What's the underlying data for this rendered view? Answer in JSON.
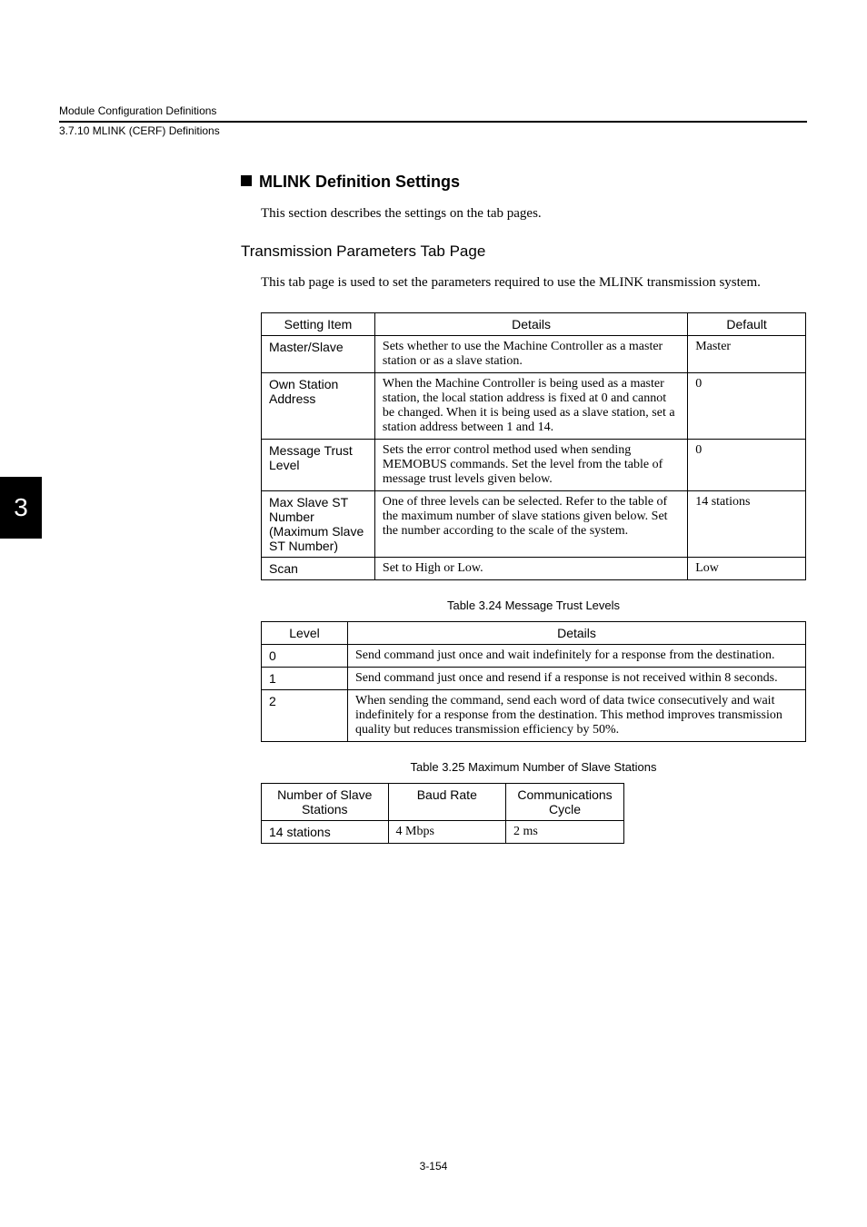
{
  "runhead": {
    "line1": "Module Configuration Definitions",
    "line2": "3.7.10  MLINK (CERF) Definitions"
  },
  "side_tab": "3",
  "section_title": "MLINK Definition Settings",
  "section_intro": "This section describes the settings on the tab pages.",
  "subsection_title": "Transmission Parameters Tab Page",
  "subsection_intro": "This tab page is used to set the parameters required to use the MLINK transmission system.",
  "table1": {
    "headers": {
      "c1": "Setting Item",
      "c2": "Details",
      "c3": "Default"
    },
    "rows": [
      {
        "item": "Master/Slave",
        "details": "Sets whether to use the Machine Controller as a master station or as a slave station.",
        "def": "Master"
      },
      {
        "item": "Own Station Address",
        "details": "When the Machine Controller is being used as a master station, the local station address is fixed at 0 and cannot be changed. When it is being used as a slave station, set a station address between 1 and 14.",
        "def": "0"
      },
      {
        "item": "Message Trust Level",
        "details": "Sets the error control method used when sending MEMOBUS commands. Set the level from the table of message trust levels given below.",
        "def": "0"
      },
      {
        "item": "Max Slave ST Number (Maximum Slave ST Number)",
        "details": "One of three levels can be selected. Refer to the table of the maximum number of slave stations given below. Set the number according to the scale of the system.",
        "def": "14 stations"
      },
      {
        "item": "Scan",
        "details": "Set to High or Low.",
        "def": "Low"
      }
    ]
  },
  "table2": {
    "caption": "Table 3.24  Message Trust Levels",
    "headers": {
      "c1": "Level",
      "c2": "Details"
    },
    "rows": [
      {
        "level": "0",
        "details": "Send command just once and wait indefinitely for a response from the destination."
      },
      {
        "level": "1",
        "details": "Send command just once and resend if a response is not received within 8 seconds."
      },
      {
        "level": "2",
        "details": "When sending the command, send each word of data twice consecutively and wait indefinitely for a response from the destination. This method improves transmission quality but reduces transmission efficiency by 50%."
      }
    ]
  },
  "table3": {
    "caption": "Table 3.25  Maximum Number of Slave Stations",
    "headers": {
      "c1": "Number of Slave Stations",
      "c2": "Baud Rate",
      "c3": "Communications Cycle"
    },
    "rows": [
      {
        "n": "14 stations",
        "baud": "4 Mbps",
        "cycle": "2 ms"
      }
    ]
  },
  "page_number": "3-154"
}
